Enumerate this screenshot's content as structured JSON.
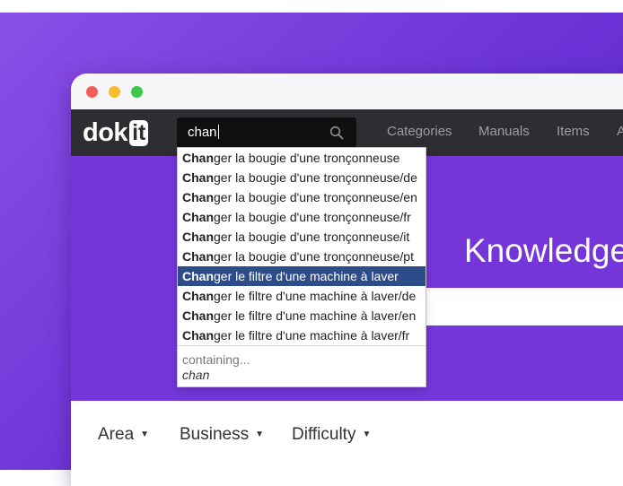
{
  "app": {
    "logo_text": "dok",
    "logo_box": "it"
  },
  "search": {
    "value": "chan",
    "icon": "search-icon"
  },
  "nav": {
    "items": [
      {
        "label": "Categories"
      },
      {
        "label": "Manuals"
      },
      {
        "label": "Items"
      },
      {
        "label": "A"
      }
    ]
  },
  "hero": {
    "title": "Knowledge"
  },
  "autocomplete": {
    "match": "Chan",
    "items": [
      {
        "rest": "ger la bougie d'une tronçonneuse",
        "active": false
      },
      {
        "rest": "ger la bougie d'une tronçonneuse/de",
        "active": false
      },
      {
        "rest": "ger la bougie d'une tronçonneuse/en",
        "active": false
      },
      {
        "rest": "ger la bougie d'une tronçonneuse/fr",
        "active": false
      },
      {
        "rest": "ger la bougie d'une tronçonneuse/it",
        "active": false
      },
      {
        "rest": "ger la bougie d'une tronçonneuse/pt",
        "active": false
      },
      {
        "rest": "ger le filtre d'une machine à laver",
        "active": true
      },
      {
        "rest": "ger le filtre d'une machine à laver/de",
        "active": false
      },
      {
        "rest": "ger le filtre d'une machine à laver/en",
        "active": false
      },
      {
        "rest": "ger le filtre d'une machine à laver/fr",
        "active": false
      }
    ],
    "containing_label": "containing...",
    "containing_query": "chan"
  },
  "filters": [
    {
      "label": "Area"
    },
    {
      "label": "Business"
    },
    {
      "label": "Difficulty"
    }
  ],
  "colors": {
    "background_gradient": "#7b3fe0",
    "navbar": "#2e2e32",
    "hero": "#7436d8",
    "active_item": "#2c4c8a"
  }
}
